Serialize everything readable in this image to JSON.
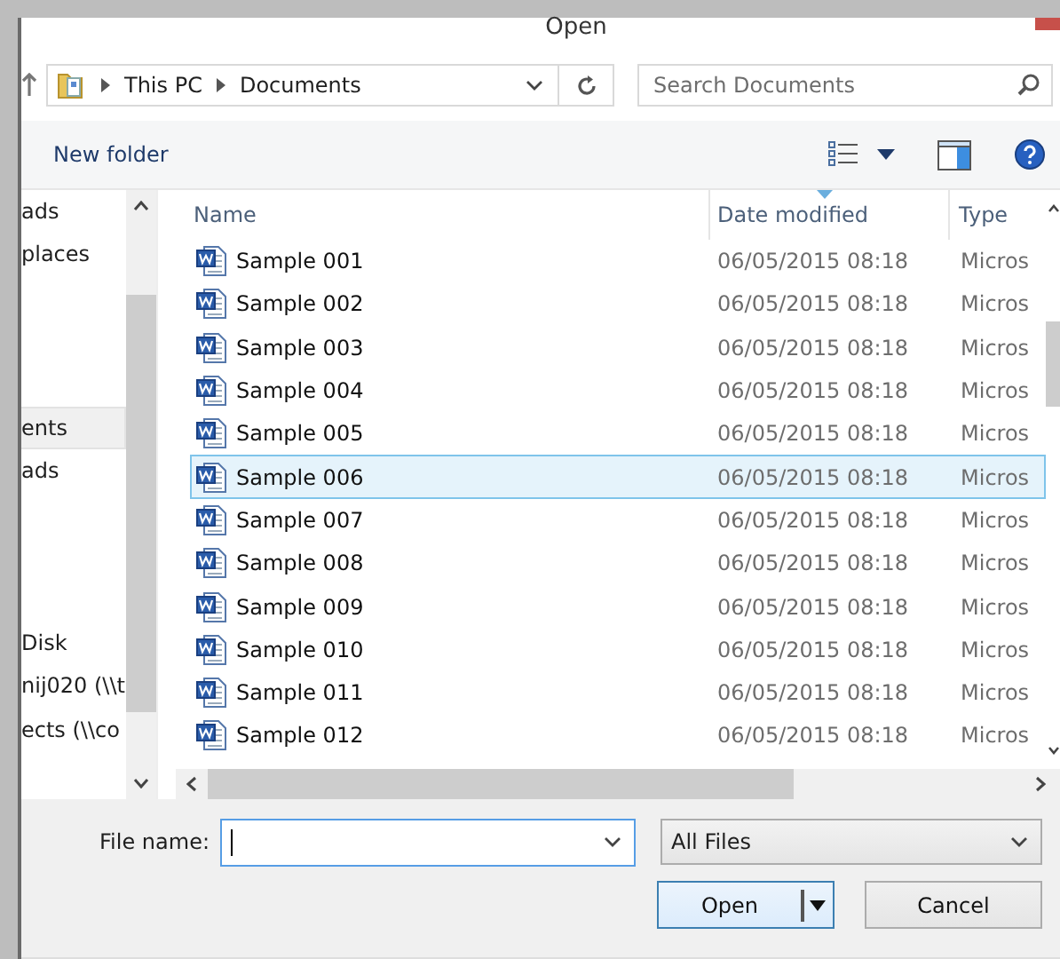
{
  "window": {
    "title": "Open"
  },
  "address": {
    "crumbs": [
      "This PC",
      "Documents"
    ]
  },
  "search": {
    "placeholder": "Search Documents"
  },
  "toolbar": {
    "new_folder": "New folder"
  },
  "sidebar": {
    "groups": [
      [
        {
          "label": "ads",
          "selected": false
        },
        {
          "label": "places",
          "selected": false
        }
      ],
      [
        {
          "label": "ents",
          "selected": true
        },
        {
          "label": "ads",
          "selected": false
        }
      ],
      [
        {
          "label": "Disk",
          "selected": false
        },
        {
          "label": "nij020 (\\\\t",
          "selected": false
        },
        {
          "label": "ects (\\\\co",
          "selected": false
        }
      ]
    ]
  },
  "table": {
    "columns": [
      "Name",
      "Date modified",
      "Type"
    ],
    "rows": [
      {
        "name": "Sample 001",
        "date": "06/05/2015 08:18",
        "type": "Micros",
        "selected": false
      },
      {
        "name": "Sample 002",
        "date": "06/05/2015 08:18",
        "type": "Micros",
        "selected": false
      },
      {
        "name": "Sample 003",
        "date": "06/05/2015 08:18",
        "type": "Micros",
        "selected": false
      },
      {
        "name": "Sample 004",
        "date": "06/05/2015 08:18",
        "type": "Micros",
        "selected": false
      },
      {
        "name": "Sample 005",
        "date": "06/05/2015 08:18",
        "type": "Micros",
        "selected": false
      },
      {
        "name": "Sample 006",
        "date": "06/05/2015 08:18",
        "type": "Micros",
        "selected": true
      },
      {
        "name": "Sample 007",
        "date": "06/05/2015 08:18",
        "type": "Micros",
        "selected": false
      },
      {
        "name": "Sample 008",
        "date": "06/05/2015 08:18",
        "type": "Micros",
        "selected": false
      },
      {
        "name": "Sample 009",
        "date": "06/05/2015 08:18",
        "type": "Micros",
        "selected": false
      },
      {
        "name": "Sample 010",
        "date": "06/05/2015 08:18",
        "type": "Micros",
        "selected": false
      },
      {
        "name": "Sample 011",
        "date": "06/05/2015 08:18",
        "type": "Micros",
        "selected": false
      },
      {
        "name": "Sample 012",
        "date": "06/05/2015 08:18",
        "type": "Micros",
        "selected": false
      }
    ]
  },
  "footer": {
    "file_name_label": "File name:",
    "filter": "All Files",
    "buttons": [
      "Open",
      "Cancel"
    ]
  }
}
